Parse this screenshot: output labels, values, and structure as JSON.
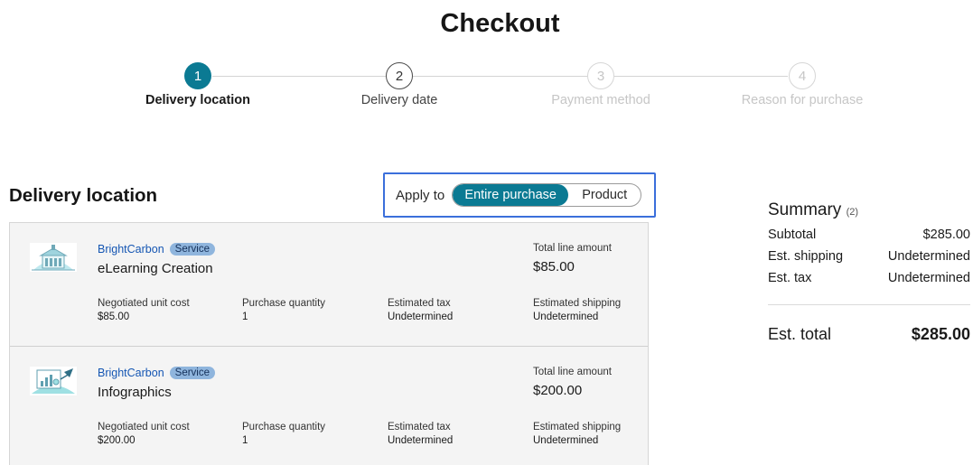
{
  "page": {
    "title": "Checkout"
  },
  "stepper": {
    "steps": [
      {
        "num": "1",
        "label": "Delivery location",
        "state": "active"
      },
      {
        "num": "2",
        "label": "Delivery date",
        "state": "next"
      },
      {
        "num": "3",
        "label": "Payment method",
        "state": "disabled"
      },
      {
        "num": "4",
        "label": "Reason for purchase",
        "state": "disabled"
      }
    ]
  },
  "delivery": {
    "title": "Delivery location",
    "apply_to": {
      "label": "Apply to",
      "options": [
        "Entire purchase",
        "Product"
      ],
      "selected": "Entire purchase"
    },
    "items": [
      {
        "icon": "building-thumbnail-icon",
        "vendor": "BrightCarbon",
        "badge": "Service",
        "product": "eLearning Creation",
        "total_label": "Total line amount",
        "total": "$85.00",
        "details": [
          {
            "label": "Negotiated unit cost",
            "value": "$85.00"
          },
          {
            "label": "Purchase quantity",
            "value": "1"
          },
          {
            "label": "Estimated tax",
            "value": "Undetermined"
          },
          {
            "label": "Estimated shipping",
            "value": "Undetermined"
          }
        ]
      },
      {
        "icon": "infographic-thumbnail-icon",
        "vendor": "BrightCarbon",
        "badge": "Service",
        "product": "Infographics",
        "total_label": "Total line amount",
        "total": "$200.00",
        "details": [
          {
            "label": "Negotiated unit cost",
            "value": "$200.00"
          },
          {
            "label": "Purchase quantity",
            "value": "1"
          },
          {
            "label": "Estimated tax",
            "value": "Undetermined"
          },
          {
            "label": "Estimated shipping",
            "value": "Undetermined"
          }
        ]
      }
    ]
  },
  "summary": {
    "title": "Summary",
    "count": "(2)",
    "rows": [
      {
        "label": "Subtotal",
        "value": "$285.00"
      },
      {
        "label": "Est. shipping",
        "value": "Undetermined"
      },
      {
        "label": "Est. tax",
        "value": "Undetermined"
      }
    ],
    "total_label": "Est. total",
    "total_value": "$285.00"
  },
  "colors": {
    "accent": "#0b7a93",
    "highlight_border": "#3b6fdb",
    "link": "#1556b3",
    "badge": "#8fb5dd"
  }
}
